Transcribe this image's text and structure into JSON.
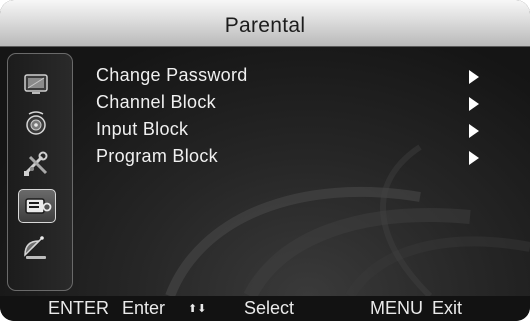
{
  "title": "Parental",
  "sidebar": {
    "icons": [
      {
        "name": "picture-icon",
        "selected": false
      },
      {
        "name": "sound-icon",
        "selected": false
      },
      {
        "name": "setup-tools-icon",
        "selected": false
      },
      {
        "name": "parental-lock-icon",
        "selected": true
      },
      {
        "name": "channel-antenna-icon",
        "selected": false
      }
    ]
  },
  "menu": {
    "items": [
      {
        "label": "Change Password",
        "arrow": "right-arrow-icon"
      },
      {
        "label": "Channel Block",
        "arrow": "right-arrow-icon"
      },
      {
        "label": "Input Block",
        "arrow": "right-arrow-icon"
      },
      {
        "label": "Program Block",
        "arrow": "right-arrow-icon"
      }
    ]
  },
  "footer": {
    "enter_key": "ENTER",
    "enter_action": "Enter",
    "select_arrows": "⬆⬇",
    "select_action": "Select",
    "menu_key": "MENU",
    "menu_action": "Exit"
  },
  "colors": {
    "title_bar": "#d6d6d6",
    "background": "#121212",
    "text": "#f0f0f0"
  }
}
